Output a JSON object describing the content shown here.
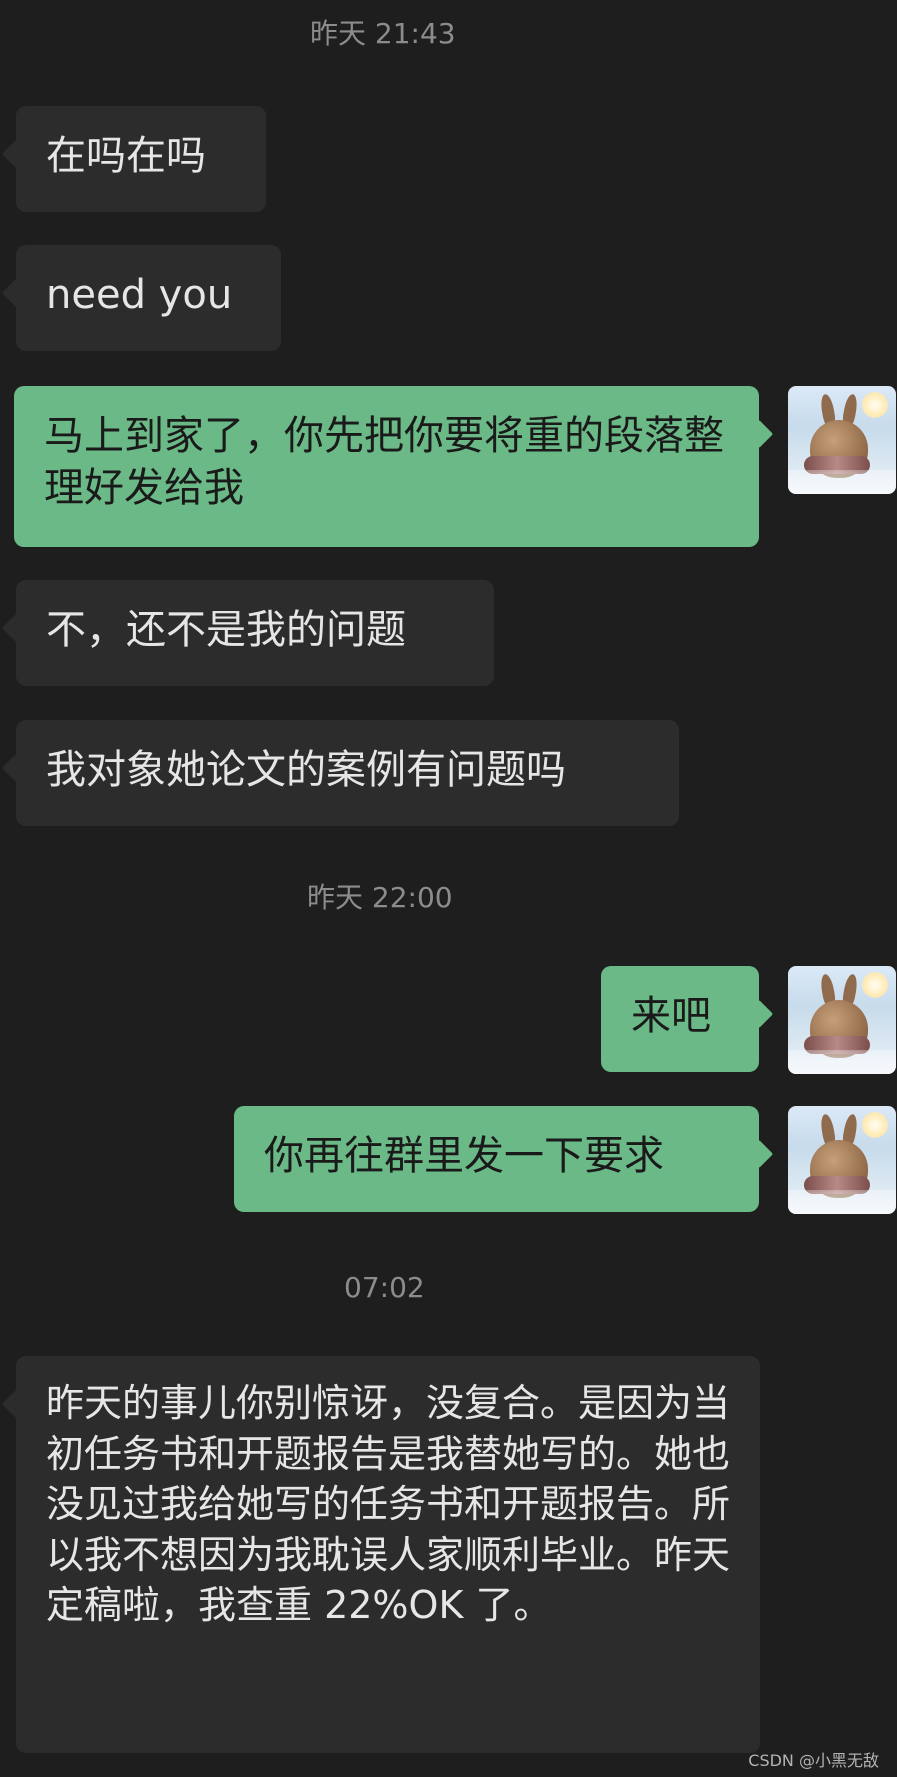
{
  "chat": {
    "time_1": "昨天 21:43",
    "msg_1": "在吗在吗",
    "msg_2": "need you",
    "msg_3": "马上到家了，你先把你要将重的段落整理好发给我",
    "msg_4": "不，还不是我的问题",
    "msg_5": "我对象她论文的案例有问题吗",
    "time_2": "昨天 22:00",
    "msg_6": "来吧",
    "msg_7": "你再往群里发一下要求",
    "time_3": "07:02",
    "msg_8": "昨天的事儿你别惊讶，没复合。是因为当初任务书和开题报告是我替她写的。她也没见过我给她写的任务书和开题报告。所以我不想因为我耽误人家顺利毕业。昨天定稿啦，我查重 22%OK 了。"
  },
  "footer": {
    "watermark": "CSDN @小黑无敌"
  }
}
